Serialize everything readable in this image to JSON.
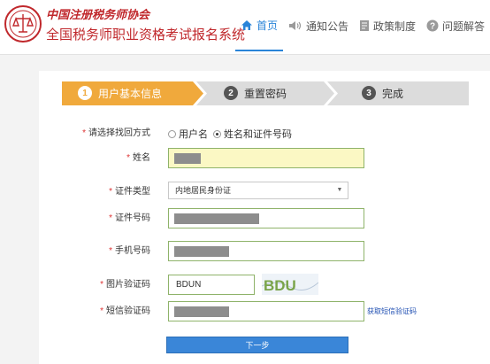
{
  "header": {
    "org_calligraphy": "中国注册税务师协会",
    "system_title": "全国税务师职业资格考试报名系统",
    "nav": [
      {
        "label": "首页",
        "icon": "home-icon",
        "active": true
      },
      {
        "label": "通知公告",
        "icon": "speaker-icon",
        "active": false
      },
      {
        "label": "政策制度",
        "icon": "document-icon",
        "active": false
      },
      {
        "label": "问题解答",
        "icon": "question-icon",
        "active": false
      }
    ]
  },
  "steps": [
    {
      "num": "1",
      "label": "用户基本信息",
      "active": true
    },
    {
      "num": "2",
      "label": "重置密码",
      "active": false
    },
    {
      "num": "3",
      "label": "完成",
      "active": false
    }
  ],
  "form": {
    "method": {
      "label": "请选择找回方式",
      "options": [
        "用户名",
        "姓名和证件号码"
      ],
      "selected": 1
    },
    "name": {
      "label": "姓名"
    },
    "id_type": {
      "label": "证件类型",
      "value": "内地居民身份证"
    },
    "id_number": {
      "label": "证件号码"
    },
    "phone": {
      "label": "手机号码"
    },
    "captcha": {
      "label": "图片验证码",
      "value": "BDUN",
      "image_text": "BDU"
    },
    "sms": {
      "label": "短信验证码",
      "link": "获取短信验证码"
    },
    "next_button": "下一步"
  },
  "colors": {
    "accent": "#2a84d8",
    "step_active": "#f0a93c",
    "brand_red": "#c0282c"
  }
}
